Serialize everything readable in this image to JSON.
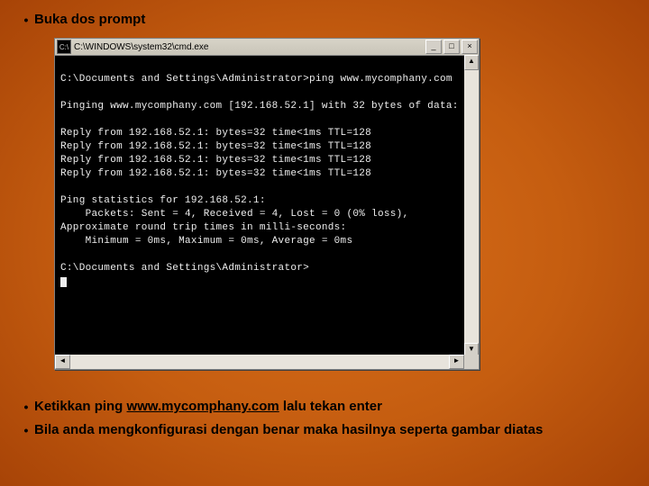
{
  "bullets": {
    "b1": "Buka dos prompt",
    "b2_pre": "Ketikkan ping ",
    "b2_link": "www.mycomphany.com",
    "b2_post": " lalu tekan enter",
    "b3": "Bila anda mengkonfigurasi dengan benar maka hasilnya seperta gambar diatas"
  },
  "cmd": {
    "title": "C:\\WINDOWS\\system32\\cmd.exe",
    "icon": "C:\\",
    "body": "\nC:\\Documents and Settings\\Administrator>ping www.mycomphany.com\n\nPinging www.mycomphany.com [192.168.52.1] with 32 bytes of data:\n\nReply from 192.168.52.1: bytes=32 time<1ms TTL=128\nReply from 192.168.52.1: bytes=32 time<1ms TTL=128\nReply from 192.168.52.1: bytes=32 time<1ms TTL=128\nReply from 192.168.52.1: bytes=32 time<1ms TTL=128\n\nPing statistics for 192.168.52.1:\n    Packets: Sent = 4, Received = 4, Lost = 0 (0% loss),\nApproximate round trip times in milli-seconds:\n    Minimum = 0ms, Maximum = 0ms, Average = 0ms\n\nC:\\Documents and Settings\\Administrator>",
    "buttons": {
      "min": "_",
      "max": "□",
      "close": "×"
    },
    "scroll": {
      "up": "▲",
      "down": "▼",
      "left": "◄",
      "right": "►"
    }
  }
}
